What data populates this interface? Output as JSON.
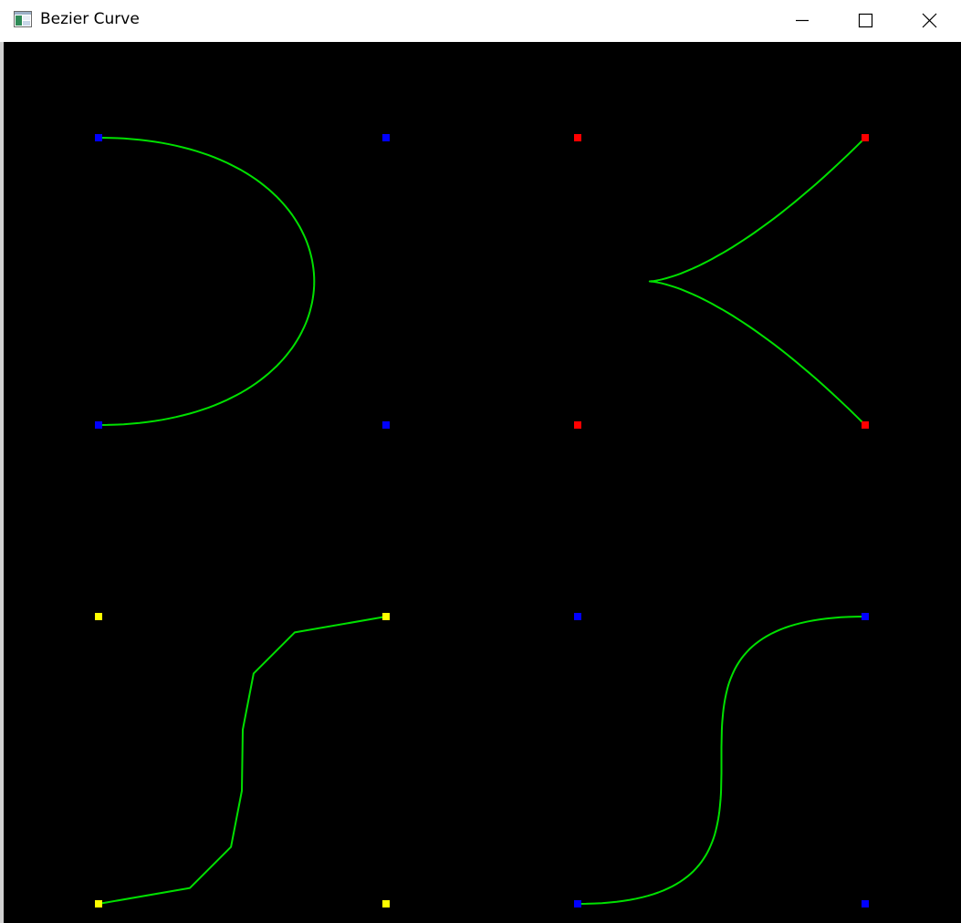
{
  "window": {
    "title": "Bezier Curve",
    "app_icon": "window-app-icon",
    "controls": {
      "minimize_icon": "minimize-icon",
      "maximize_icon": "maximize-icon",
      "close_icon": "close-icon"
    }
  },
  "colors": {
    "canvas_background": "#000000",
    "curve": "#00e000",
    "blue_point": "#0000ff",
    "red_point": "#ff0000",
    "yellow_point": "#ffff00"
  },
  "curves": [
    {
      "id": "top-left",
      "point_color": "#0000ff",
      "control_points": [
        [
          104,
          105
        ],
        [
          419,
          105
        ],
        [
          419,
          420
        ],
        [
          104,
          420
        ]
      ],
      "style": "smooth"
    },
    {
      "id": "top-right",
      "point_color": "#ff0000",
      "control_points": [
        [
          944,
          105
        ],
        [
          629,
          420
        ],
        [
          629,
          105
        ],
        [
          944,
          420
        ]
      ],
      "style": "smooth"
    },
    {
      "id": "bottom-left",
      "point_color": "#ffff00",
      "control_points": [
        [
          104,
          945
        ],
        [
          419,
          945
        ],
        [
          104,
          630
        ],
        [
          419,
          630
        ]
      ],
      "style": "polyline",
      "segments": 7
    },
    {
      "id": "bottom-right",
      "point_color": "#0000ff",
      "control_points": [
        [
          629,
          945
        ],
        [
          944,
          945
        ],
        [
          629,
          630
        ],
        [
          944,
          630
        ]
      ],
      "style": "smooth"
    }
  ]
}
